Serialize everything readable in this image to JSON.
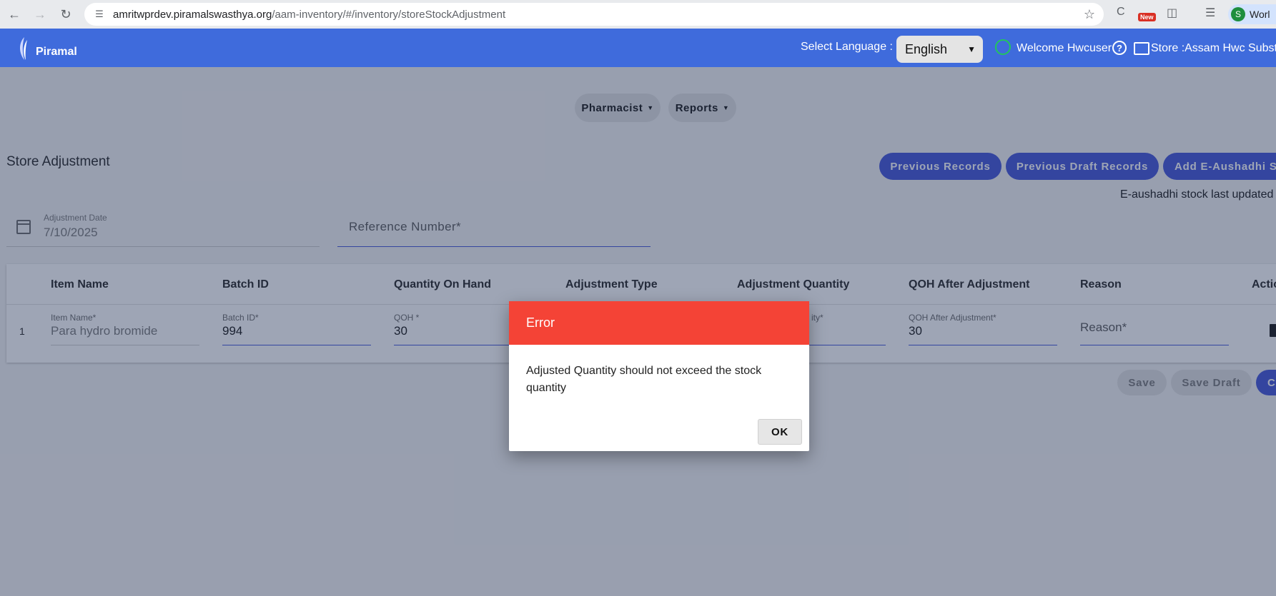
{
  "browser": {
    "url_domain": "amritwprdev.piramalswasthya.org",
    "url_path": "/aam-inventory/#/inventory/storeStockAdjustment",
    "new_badge": "New",
    "profile_initial": "S",
    "profile_label": "Worl"
  },
  "header": {
    "logo_text": "Piramal",
    "select_language_label": "Select Language :",
    "language_value": "English",
    "welcome_text": "Welcome Hwcuser",
    "help_glyph": "?",
    "store_text": "Store :Assam Hwc Substo"
  },
  "menu": {
    "pharmacist": "Pharmacist",
    "reports": "Reports"
  },
  "page": {
    "title": "Store Adjustment",
    "previous_records": "Previous Records",
    "previous_draft_records": "Previous Draft Records",
    "add_eaushadhi": "Add E-Aushadhi S",
    "eaushadhi_updated": "E-aushadhi stock last updated o"
  },
  "form": {
    "adjustment_date_label": "Adjustment Date",
    "adjustment_date_value": "7/10/2025",
    "reference_number_placeholder": "Reference Number*"
  },
  "table": {
    "headers": {
      "item_name": "Item Name",
      "batch_id": "Batch ID",
      "quantity_on_hand": "Quantity On Hand",
      "adjustment_type": "Adjustment Type",
      "adjustment_quantity": "Adjustment Quantity",
      "qoh_after": "QOH After Adjustment",
      "reason": "Reason",
      "action": "Actio"
    },
    "row": {
      "index": "1",
      "item_name_label": "Item Name*",
      "item_name_value": "Para hydro bromide",
      "batch_id_label": "Batch ID*",
      "batch_id_value": "994",
      "qoh_label": "QOH *",
      "qoh_value": "30",
      "adj_qty_label_partial": "ity*",
      "qoh_after_label": "QOH After Adjustment*",
      "qoh_after_value": "30",
      "reason_placeholder": "Reason*"
    }
  },
  "actions": {
    "save": "Save",
    "save_draft": "Save Draft",
    "third_partial": "C"
  },
  "dialog": {
    "title": "Error",
    "message": "Adjusted Quantity should not exceed the stock quantity",
    "ok": "OK"
  },
  "colors": {
    "primary": "#3f51d8",
    "appbar": "#3f6bdc",
    "error": "#f44336"
  }
}
